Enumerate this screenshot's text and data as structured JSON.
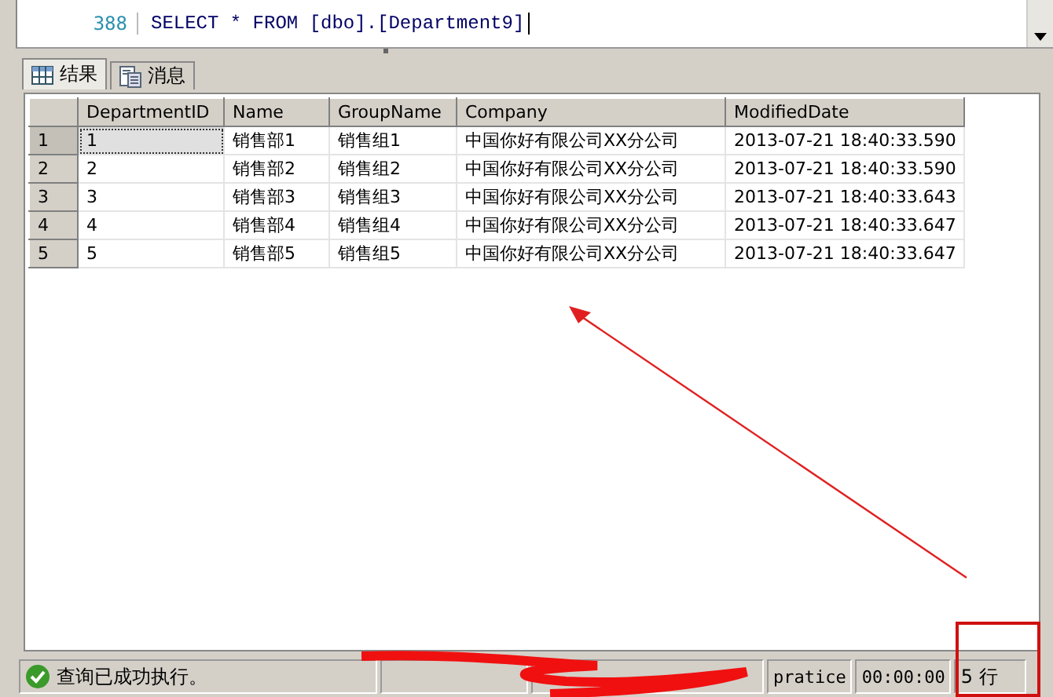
{
  "editor": {
    "lines": [
      {
        "number": "388",
        "code": "SELECT * FROM [dbo].[Department9]"
      }
    ]
  },
  "tabs": [
    {
      "label": "结果",
      "selected": true
    },
    {
      "label": "消息",
      "selected": false
    }
  ],
  "table": {
    "columns": [
      "DepartmentID",
      "Name",
      "GroupName",
      "Company",
      "ModifiedDate"
    ],
    "rows": [
      {
        "number": "1",
        "selected": true,
        "cells": [
          "1",
          "销售部1",
          "销售组1",
          "中国你好有限公司XX分公司",
          "2013-07-21 18:40:33.590"
        ]
      },
      {
        "number": "2",
        "selected": false,
        "cells": [
          "2",
          "销售部2",
          "销售组2",
          "中国你好有限公司XX分公司",
          "2013-07-21 18:40:33.590"
        ]
      },
      {
        "number": "3",
        "selected": false,
        "cells": [
          "3",
          "销售部3",
          "销售组3",
          "中国你好有限公司XX分公司",
          "2013-07-21 18:40:33.643"
        ]
      },
      {
        "number": "4",
        "selected": false,
        "cells": [
          "4",
          "销售部4",
          "销售组4",
          "中国你好有限公司XX分公司",
          "2013-07-21 18:40:33.647"
        ]
      },
      {
        "number": "5",
        "selected": false,
        "cells": [
          "5",
          "销售部5",
          "销售组5",
          "中国你好有限公司XX分公司",
          "2013-07-21 18:40:33.647"
        ]
      }
    ]
  },
  "status_bar": {
    "message": "查询已成功执行。",
    "database": "pratice",
    "elapsed": "00:00:00",
    "row_count": "5 行"
  }
}
